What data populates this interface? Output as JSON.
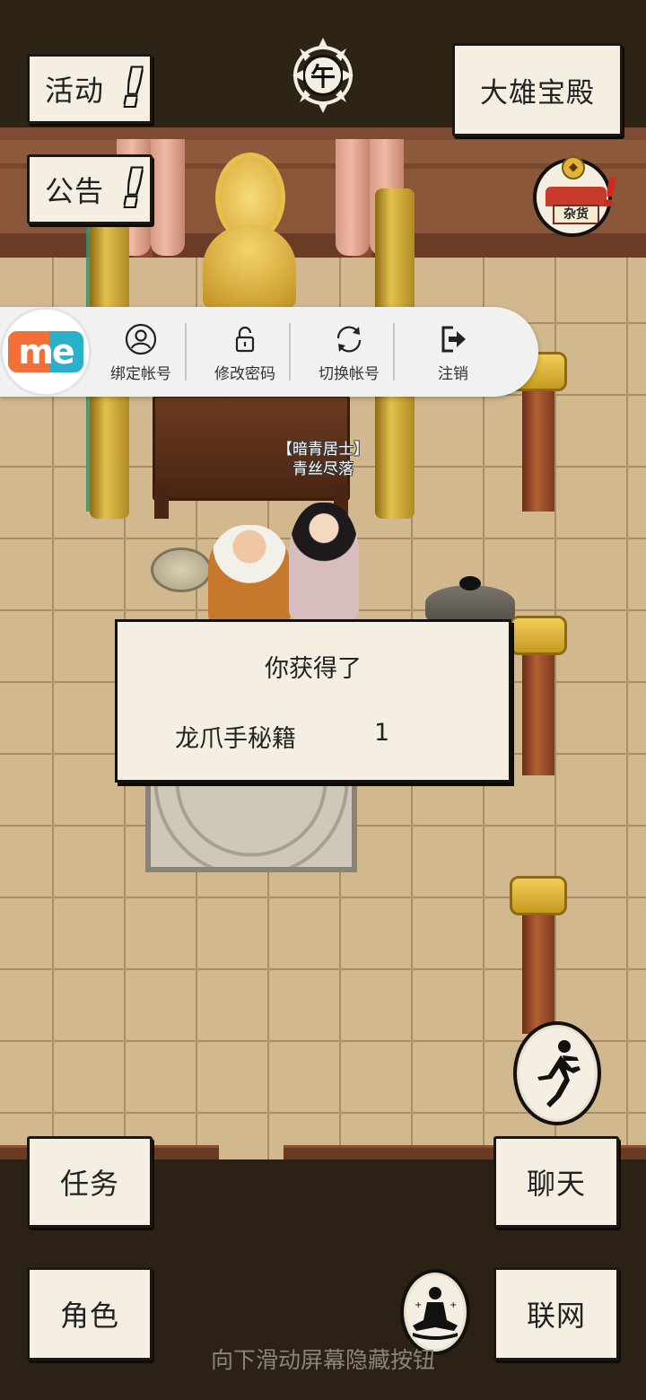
{
  "hud": {
    "activity_label": "活动",
    "notice_label": "公告",
    "location_label": "大雄宝殿",
    "time_glyph": "午",
    "alert_mark": "!"
  },
  "shop": {
    "sign_text": "杂货",
    "alert_mark": "!"
  },
  "npc": {
    "title": "【暗青居士】",
    "name": "青丝尽落"
  },
  "sdk_toolbar": {
    "logo_text": "me",
    "items": [
      {
        "label": "绑定帐号",
        "icon": "user-circle-icon"
      },
      {
        "label": "修改密码",
        "icon": "lock-icon"
      },
      {
        "label": "切换帐号",
        "icon": "refresh-icon"
      },
      {
        "label": "注销",
        "icon": "logout-icon"
      }
    ]
  },
  "reward_dialog": {
    "title": "你获得了",
    "item_name": "龙爪手秘籍",
    "item_qty": "1"
  },
  "bottom_menu": {
    "task_label": "任务",
    "chat_label": "聊天",
    "role_label": "角色",
    "network_label": "联网",
    "run_icon": "running-man-icon",
    "meditate_icon": "meditation-icon"
  },
  "hint_text": "向下滑动屏幕隐藏按钮"
}
